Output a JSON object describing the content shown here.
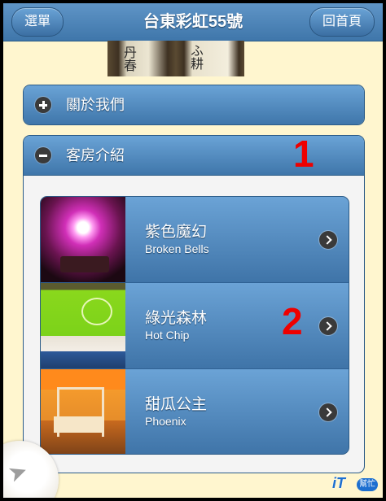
{
  "header": {
    "menu_label": "選單",
    "title": "台東彩虹55號",
    "home_label": "回首頁"
  },
  "banner_photo": {
    "visible_ink_a": "丹春",
    "visible_ink_b": "ふ耕"
  },
  "sections": [
    {
      "label": "關於我們",
      "expanded": false,
      "icon": "plus-icon"
    },
    {
      "label": "客房介紹",
      "expanded": true,
      "icon": "minus-icon"
    }
  ],
  "annotations": {
    "marker_1": "1",
    "marker_2": "2"
  },
  "rooms": [
    {
      "title": "紫色魔幻",
      "subtitle": "Broken Bells",
      "icon": "chevron-right-icon"
    },
    {
      "title": "綠光森林",
      "subtitle": "Hot Chip",
      "icon": "chevron-right-icon"
    },
    {
      "title": "甜瓜公主",
      "subtitle": "Phoenix",
      "icon": "chevron-right-icon"
    }
  ],
  "watermark": {
    "text_it": "iT",
    "text_badge": "幫忙"
  },
  "colors": {
    "bar": "#4a82b8",
    "background": "#fff6cf",
    "annotation": "#e00000"
  }
}
